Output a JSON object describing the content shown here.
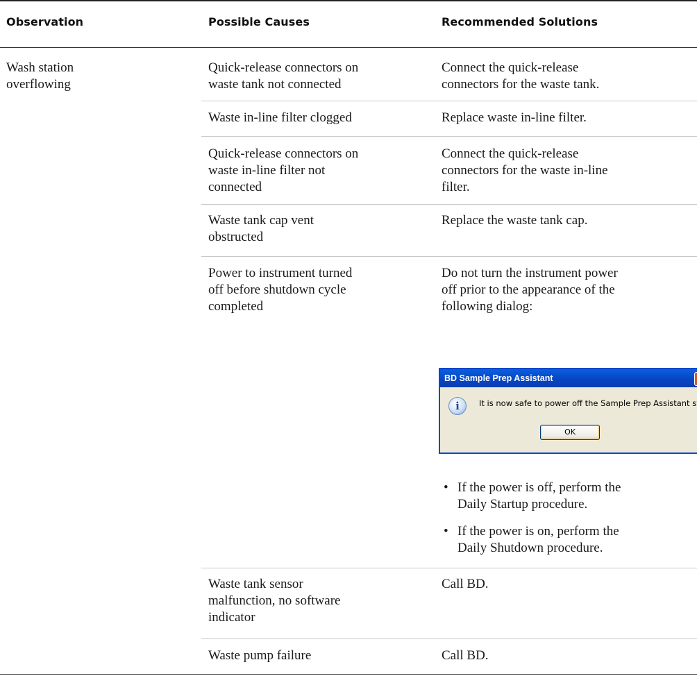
{
  "table": {
    "headers": [
      "Observation",
      "Possible Causes",
      "Recommended Solutions"
    ],
    "observation": [
      "Wash station",
      "overflowing"
    ],
    "rows": [
      {
        "cause": [
          "Quick-release connectors on",
          "waste tank not connected"
        ],
        "solution": [
          "Connect the quick-release",
          "connectors for the waste tank."
        ]
      },
      {
        "cause": [
          "Waste in-line filter clogged"
        ],
        "solution": [
          "Replace waste in-line filter."
        ]
      },
      {
        "cause": [
          "Quick-release connectors on",
          "waste in-line filter not",
          "connected"
        ],
        "solution": [
          "Connect the quick-release",
          "connectors for the waste in-line",
          "filter."
        ]
      },
      {
        "cause": [
          "Waste tank cap vent",
          "obstructed"
        ],
        "solution": [
          "Replace the waste tank cap."
        ]
      },
      {
        "cause": [
          "Power to instrument turned",
          "off before shutdown cycle",
          "completed"
        ],
        "solution": [
          "Do not turn the instrument power",
          "off prior to the appearance of the",
          "following dialog:"
        ],
        "bullets": [
          [
            "If the power is off, perform the",
            "Daily Startup procedure."
          ],
          [
            "If the power is on, perform the",
            "Daily Shutdown procedure."
          ]
        ]
      },
      {
        "cause": [
          "Waste tank sensor",
          "malfunction, no software",
          "indicator"
        ],
        "solution": [
          "Call BD."
        ]
      },
      {
        "cause": [
          "Waste pump failure"
        ],
        "solution": [
          "Call BD."
        ]
      }
    ]
  },
  "dialog": {
    "title": "BD Sample Prep Assistant",
    "message": "It is now safe to power off the Sample Prep Assistant syste",
    "ok_label": "OK",
    "icon": "info-icon",
    "close_icon": "close-icon"
  },
  "colors": {
    "title_bar": "#0746c4",
    "dialog_bg": "#ece9d8",
    "close_button": "#d9542b"
  }
}
